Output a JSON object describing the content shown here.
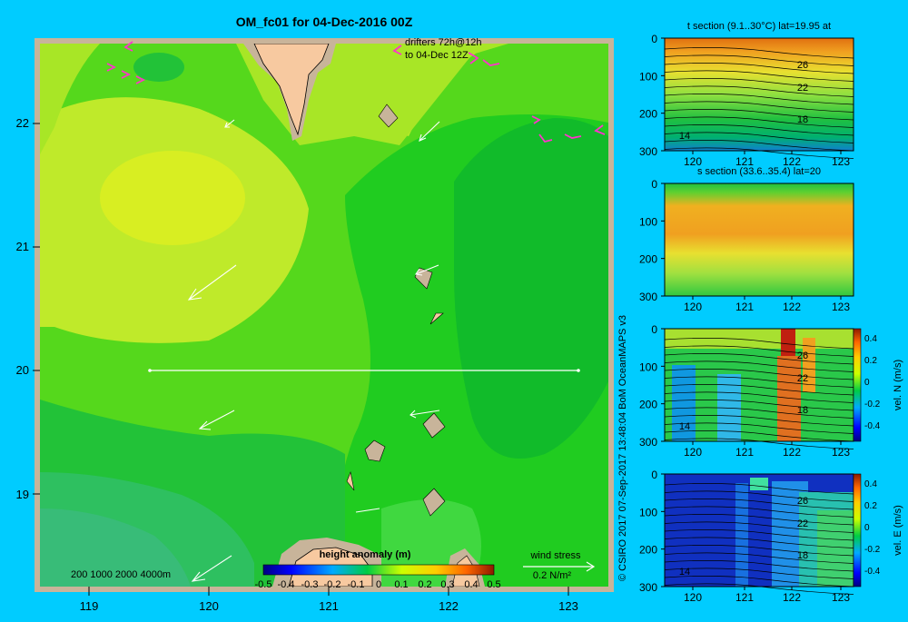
{
  "map": {
    "title": "OM_fc01 for 04-Dec-2016 00Z",
    "drifters_line1": "drifters 72h@12h",
    "drifters_line2": "to 04-Dec 12Z",
    "lon_ticks": [
      "119",
      "120",
      "121",
      "122",
      "123"
    ],
    "lat_ticks": [
      "22",
      "21",
      "20",
      "19"
    ],
    "depth_legend": "200  1000  2000  4000m",
    "colorbar_label": "height anomaly  (m)",
    "colorbar_ticks": [
      "-0.5",
      "-0.4",
      "-0.3",
      "-0.2",
      "-0.1",
      "0",
      "0.1",
      "0.2",
      "0.3",
      "0.4",
      "0.5"
    ],
    "wind_stress_label": "wind stress",
    "wind_stress_scale": "0.2 N/m²",
    "section_lat": 20,
    "section_lon_range": [
      119.5,
      123.2
    ]
  },
  "panels": [
    {
      "id": "t",
      "title": "t section (9.1..30°C) lat=19.95 at",
      "y_ticks": [
        "0",
        "100",
        "200",
        "300"
      ],
      "x_ticks": [
        "120",
        "121",
        "122",
        "123"
      ],
      "contour_labels": [
        "26",
        "22",
        "18",
        "14"
      ],
      "colorbar": false
    },
    {
      "id": "s",
      "title": "s section (33.6..35.4) lat=20",
      "y_ticks": [
        "0",
        "100",
        "200",
        "300"
      ],
      "x_ticks": [
        "120",
        "121",
        "122",
        "123"
      ],
      "contour_labels": [],
      "colorbar": false
    },
    {
      "id": "vn",
      "title": "",
      "y_ticks": [
        "0",
        "100",
        "200",
        "300"
      ],
      "x_ticks": [
        "120",
        "121",
        "122",
        "123"
      ],
      "contour_labels": [
        "26",
        "22",
        "18",
        "14"
      ],
      "colorbar": true,
      "colorbar_ticks": [
        "0.4",
        "0.2",
        "0",
        "-0.2",
        "-0.4"
      ],
      "colorbar_label": "vel. N  (m/s)"
    },
    {
      "id": "ve",
      "title": "",
      "y_ticks": [
        "0",
        "100",
        "200",
        "300"
      ],
      "x_ticks": [
        "120",
        "121",
        "122",
        "123"
      ],
      "contour_labels": [
        "26",
        "22",
        "18",
        "14"
      ],
      "colorbar": true,
      "colorbar_ticks": [
        "0.4",
        "0.2",
        "0",
        "-0.2",
        "-0.4"
      ],
      "colorbar_label": "vel. E  (m/s)"
    }
  ],
  "credit": "© CSIRO 2017   07-Sep-2017 13:48:04 BoM OceanMAPS v3",
  "colors": {
    "background": "#00ccff",
    "frame": "#c8b49a",
    "land": "#f7c9a0",
    "shelf": "#c8b49a",
    "drifter": "#ff33cc",
    "vector": "#ffffff"
  }
}
